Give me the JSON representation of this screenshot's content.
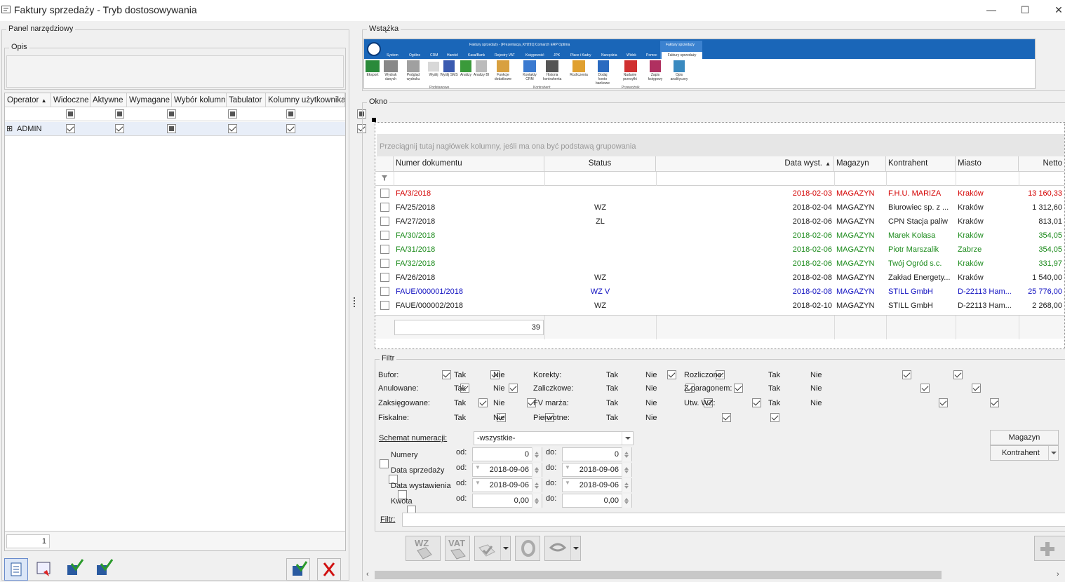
{
  "window": {
    "title": "Faktury sprzedaży - Tryb dostosowywania",
    "min": "—",
    "max": "☐",
    "close": "✕"
  },
  "left": {
    "panel_title": "Panel narzędziowy",
    "desc_title": "Opis",
    "columns": [
      "Operator",
      "Widoczne",
      "Aktywne",
      "Wymagane",
      "Wybór kolumn",
      "Tabulator",
      "Kolumny użytkownika"
    ],
    "rows": [
      {
        "operator": "ADMIN",
        "expand": "⊞"
      }
    ],
    "footer_count": "1"
  },
  "ribbon": {
    "group_title": "Wstążka",
    "app_title": "Faktury sprzedaży - [Prezentacja_KH291] Comarch ERP Optima",
    "context_tab": "Faktury sprzedaży",
    "tabs": [
      "System",
      "Ogólne",
      "CRM",
      "Handel",
      "Kasa/Bank",
      "Rejestry VAT",
      "Księgowość",
      "JPK",
      "Płace i Kadry",
      "Narzędzia",
      "Widok",
      "Pomoc",
      "Faktury sprzedaży"
    ],
    "buttons": [
      "Eksport",
      "Wydruk danych",
      "Podgląd wydruku",
      "Wyślij",
      "Wyślij SMS",
      "Analizy",
      "Analizy BI",
      "Funkcje dodatkowe",
      "Kontakty CRM",
      "Historia kontrahenta",
      "Rozliczenia",
      "Dodaj konto bankowe",
      "Nadanie przesyłki",
      "Zapis księgowy",
      "Opis analityczny"
    ],
    "groups": [
      "Podstawowe",
      "Kontrahent",
      "Przewoźnik"
    ]
  },
  "window_group": {
    "title": "Okno",
    "grouping_hint": "Przeciągnij tutaj nagłówek kolumny, jeśli ma ona być podstawą grupowania",
    "columns": [
      "Numer dokumentu",
      "Status",
      "Data wyst.",
      "Magazyn",
      "Kontrahent",
      "Miasto",
      "Netto"
    ],
    "rows": [
      {
        "num": "FA/3/2018",
        "status": "",
        "date": "2018-02-03",
        "mag": "MAGAZYN",
        "kontr": "F.H.U. MARIZA",
        "city": "Kraków",
        "net": "13 160,33",
        "color": "red"
      },
      {
        "num": "FA/25/2018",
        "status": "WZ",
        "date": "2018-02-04",
        "mag": "MAGAZYN",
        "kontr": "Biurowiec sp. z ...",
        "city": "Kraków",
        "net": "1 312,60",
        "color": "black"
      },
      {
        "num": "FA/27/2018",
        "status": "ZL",
        "date": "2018-02-06",
        "mag": "MAGAZYN",
        "kontr": "CPN Stacja paliw",
        "city": "Kraków",
        "net": "813,01",
        "color": "black"
      },
      {
        "num": "FA/30/2018",
        "status": "",
        "date": "2018-02-06",
        "mag": "MAGAZYN",
        "kontr": "Marek Kolasa",
        "city": "Kraków",
        "net": "354,05",
        "color": "green"
      },
      {
        "num": "FA/31/2018",
        "status": "",
        "date": "2018-02-06",
        "mag": "MAGAZYN",
        "kontr": "Piotr Marszalik",
        "city": "Zabrze",
        "net": "354,05",
        "color": "green"
      },
      {
        "num": "FA/32/2018",
        "status": "",
        "date": "2018-02-06",
        "mag": "MAGAZYN",
        "kontr": "Twój Ogród s.c.",
        "city": "Kraków",
        "net": "331,97",
        "color": "green"
      },
      {
        "num": "FA/26/2018",
        "status": "WZ",
        "date": "2018-02-08",
        "mag": "MAGAZYN",
        "kontr": "Zakład Energety...",
        "city": "Kraków",
        "net": "1 540,00",
        "color": "black"
      },
      {
        "num": "FAUE/000001/2018",
        "status": "WZ V",
        "date": "2018-02-08",
        "mag": "MAGAZYN",
        "kontr": "STILL GmbH",
        "city": "D-22113 Ham...",
        "net": "25 776,00",
        "color": "blue"
      },
      {
        "num": "FAUE/000002/2018",
        "status": "WZ",
        "date": "2018-02-10",
        "mag": "MAGAZYN",
        "kontr": "STILL GmbH",
        "city": "D-22113 Ham...",
        "net": "2 268,00",
        "color": "black"
      }
    ],
    "footer_count": "39"
  },
  "filter": {
    "title": "Filtr",
    "tak": "Tak",
    "nie": "Nie",
    "col1": [
      "Bufor:",
      "Anulowane:",
      "Zaksięgowane:",
      "Fiskalne:"
    ],
    "col2": [
      "Korekty:",
      "Zaliczkowe:",
      "FV marża:",
      "Pierwotne:"
    ],
    "col3": [
      "Rozliczone:",
      "Z paragonem:",
      "Utw. WZ:"
    ],
    "schemat_label": "Schemat numeracji:",
    "schemat_value": "-wszystkie-",
    "range_rows": [
      {
        "label": "Numery",
        "od": "0",
        "do": "0"
      },
      {
        "label": "Data sprzedaży",
        "od": "2018-09-06",
        "do": "2018-09-06"
      },
      {
        "label": "Data wystawienia",
        "od": "2018-09-06",
        "do": "2018-09-06"
      },
      {
        "label": "Kwota",
        "od": "0,00",
        "do": "0,00"
      }
    ],
    "od": "od:",
    "do": "do:",
    "filtr_label": "Filtr:",
    "magazyn_btn": "Magazyn",
    "kontrahent_btn": "Kontrahent"
  },
  "toolbar": {
    "wz": "WZ",
    "vat": "VAT"
  }
}
